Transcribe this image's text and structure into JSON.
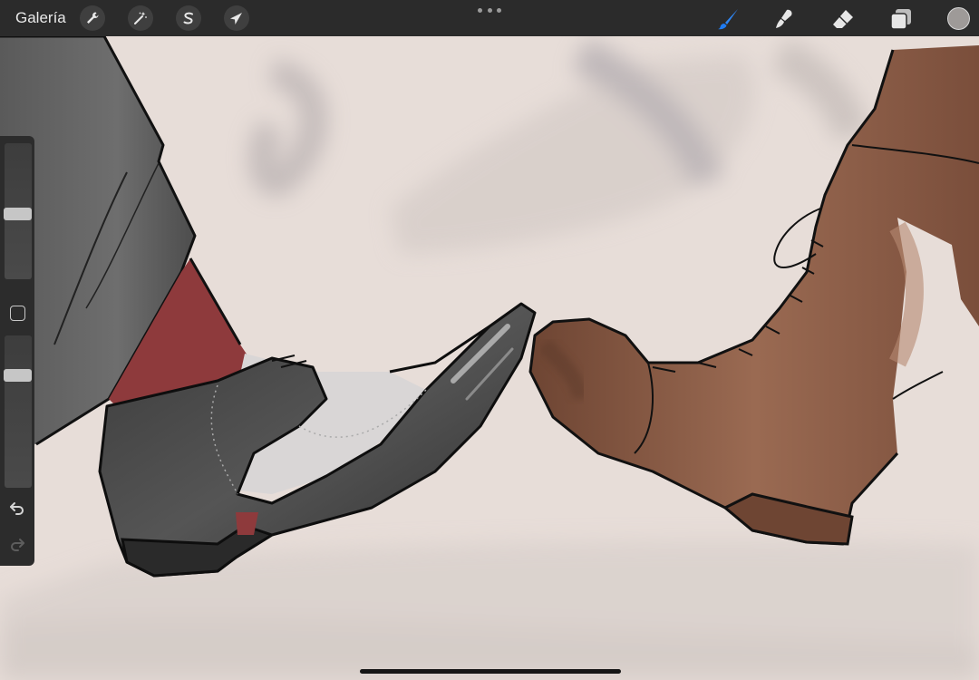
{
  "topbar": {
    "gallery_label": "Galería",
    "actions": [
      {
        "name": "actions",
        "icon": "wrench-icon"
      },
      {
        "name": "adjustments",
        "icon": "magic-wand-icon"
      },
      {
        "name": "selection",
        "icon": "selection-s-icon"
      },
      {
        "name": "transform",
        "icon": "arrow-cursor-icon"
      }
    ],
    "more_icon": "more-dots-icon",
    "tools": [
      {
        "name": "brush",
        "icon": "brush-icon",
        "active": true
      },
      {
        "name": "smudge",
        "icon": "smudge-icon",
        "active": false
      },
      {
        "name": "eraser",
        "icon": "eraser-icon",
        "active": false
      },
      {
        "name": "layers",
        "icon": "layers-icon",
        "active": false
      }
    ],
    "current_color": "#9e9a98",
    "active_tool_color": "#1f7cf2"
  },
  "sidebar": {
    "brush_size_level": 0.48,
    "opacity_level": 0.76,
    "modifier_icon": "square-modifier-icon",
    "undo_icon": "undo-icon",
    "redo_icon": "redo-icon",
    "redo_enabled": false
  },
  "canvas": {
    "background_color": "#e7ddd8",
    "brown_boot_color": "#8a5b43",
    "black_shoe_color": "#3c3c3c",
    "sock_color": "#8e3a3c"
  }
}
